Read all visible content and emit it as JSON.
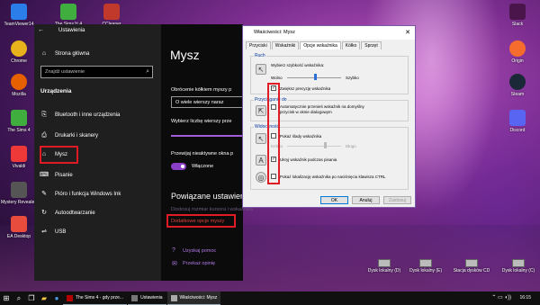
{
  "desktop_icons": [
    {
      "label": "TeamViewer14",
      "color": "#2b7de9"
    },
    {
      "label": "The Sims™ 4",
      "color": "#3fae3f"
    },
    {
      "label": "CCleaner",
      "color": "#c0392b"
    },
    {
      "label": "Slack",
      "color": "#4a154b"
    },
    {
      "label": "Chrome",
      "color": "#e8b21c"
    },
    {
      "label": "Origin",
      "color": "#f56c2d"
    },
    {
      "label": "Mozilla",
      "color": "#e66000"
    },
    {
      "label": "Steam",
      "color": "#1b2838"
    },
    {
      "label": "The Sims 4",
      "color": "#3fae3f"
    },
    {
      "label": "Vivaldi",
      "color": "#ef3939"
    },
    {
      "label": "Discord",
      "color": "#5865f2"
    },
    {
      "label": "Mystery Revealed",
      "color": "#555"
    },
    {
      "label": "EA Desktop",
      "color": "#e74c3c"
    }
  ],
  "settings": {
    "title": "Ustawienia",
    "home": "Strona główna",
    "search_placeholder": "Znajdź ustawienie",
    "section": "Urządzenia",
    "nav": [
      {
        "label": "Bluetooth i inne urządzenia",
        "icon": "⎘"
      },
      {
        "label": "Drukarki i skanery",
        "icon": "⎙"
      },
      {
        "label": "Mysz",
        "icon": "⌂"
      },
      {
        "label": "Pisanie",
        "icon": "⌨"
      },
      {
        "label": "Pióro i funkcja Windows Ink",
        "icon": "✎"
      },
      {
        "label": "Autoodtwarzanie",
        "icon": "↻"
      },
      {
        "label": "USB",
        "icon": "⇌"
      }
    ],
    "main_title": "Mysz",
    "scroll_label": "Obrócenie kółkiem myszy p",
    "scroll_value": "O wiele wierszy naraz",
    "lines_label": "Wybierz liczbę wierszy prze",
    "inactive_label": "Przewijaj nieaktywne okna p",
    "toggle_state": "Włączone",
    "related_title": "Powiązane ustawien",
    "link_size": "Dostosuj rozmiar kursora i wskaźnika",
    "link_additional": "Dodatkowe opcje myszy",
    "help": "Uzyskaj pomoc",
    "feedback": "Przekaż opinię"
  },
  "dialog": {
    "title": "Właściwości: Mysz",
    "close": "✕",
    "tabs": [
      "Przyciski",
      "Wskaźniki",
      "Opcje wskaźnika",
      "Kółko",
      "Sprzęt"
    ],
    "motion_group": "Ruch",
    "motion_label": "Wybierz szybkość wskaźnika:",
    "slow": "Wolno",
    "fast": "Szybko",
    "precision": "Zwiększ precyzję wskaźnika",
    "snap_group": "Przyciąganie do",
    "snap_text_1": "Automatycznie przenieś wskaźnik na domyślny",
    "snap_text_2": "przycisk w oknie dialogowym",
    "visibility_group": "Widoczność",
    "trails": "Pokaż ślady wskaźnika",
    "short": "Krótko",
    "long": "Długo",
    "hide_typing": "Ukryj wskaźnik podczas pisania",
    "ctrl_show": "Pokaż lokalizację wskaźnika po naciśnięciu klawisza CTRL",
    "ok": "OK",
    "cancel": "Anuluj",
    "apply": "Zastosuj"
  },
  "drives": [
    {
      "label": "Dysk lokalny (D)"
    },
    {
      "label": "Dysk lokalny (E)"
    },
    {
      "label": "Stacja dysków CD"
    },
    {
      "label": "Dysk lokalny (C)"
    }
  ],
  "taskbar": {
    "tasks": [
      {
        "label": "The Sims 4 - gdy prze..."
      },
      {
        "label": "Ustawienia"
      },
      {
        "label": "Właściwości: Mysz"
      }
    ],
    "clock": "16:15"
  }
}
